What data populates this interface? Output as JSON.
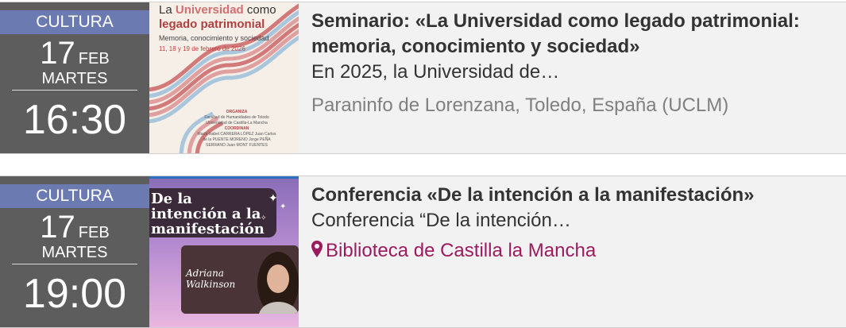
{
  "events": [
    {
      "category": "CULTURA",
      "day": "17",
      "month": "FEB",
      "weekday": "MARTES",
      "time": "16:30",
      "title": "Seminario: «La Universidad como legado patrimonial: memoria, conocimiento y sociedad»",
      "description": "En 2025, la Universidad de…",
      "location": "Paraninfo de Lorenzana, Toledo, España (UCLM)",
      "poster": {
        "line1_a": "La ",
        "line1_b": "Universidad",
        "line1_c": " como",
        "line2": "legado patrimonial",
        "subtitle": "Memoria, conocimiento y sociedad",
        "dates": "11, 18 y 19 de febrero de 2026",
        "organiza_heading": "ORGANIZA",
        "organiza_text": "Facultad de Humanidades de Toledo Universidad de Castilla-La Mancha",
        "coordinan_heading": "COORDINAN",
        "coordinan_text": "María Isabel CARRERA LÓPEZ Juan Carlos de la PUENTE MORENO Jorge PEÑA SERRANO Juan MONT FUENTES"
      }
    },
    {
      "category": "CULTURA",
      "day": "17",
      "month": "FEB",
      "weekday": "MARTES",
      "time": "19:00",
      "title": "Conferencia «De la intención a la manifestación»",
      "description": "Conferencia “De la intención…",
      "location": "Biblioteca de Castilla la Mancha",
      "poster": {
        "title_line1": "De la",
        "title_line2": "intención a la",
        "title_line3": "manifestación",
        "signature_line1": "Adriana",
        "signature_line2": "Walkinson"
      }
    }
  ],
  "colors": {
    "category_bar": "#6b7ab0",
    "date_box": "#5d5d5d",
    "card_bg": "#f2f2f2",
    "location_link": "#9b1b5e",
    "location_gray": "#808080"
  },
  "icons": {
    "location": "map-pin-icon"
  }
}
